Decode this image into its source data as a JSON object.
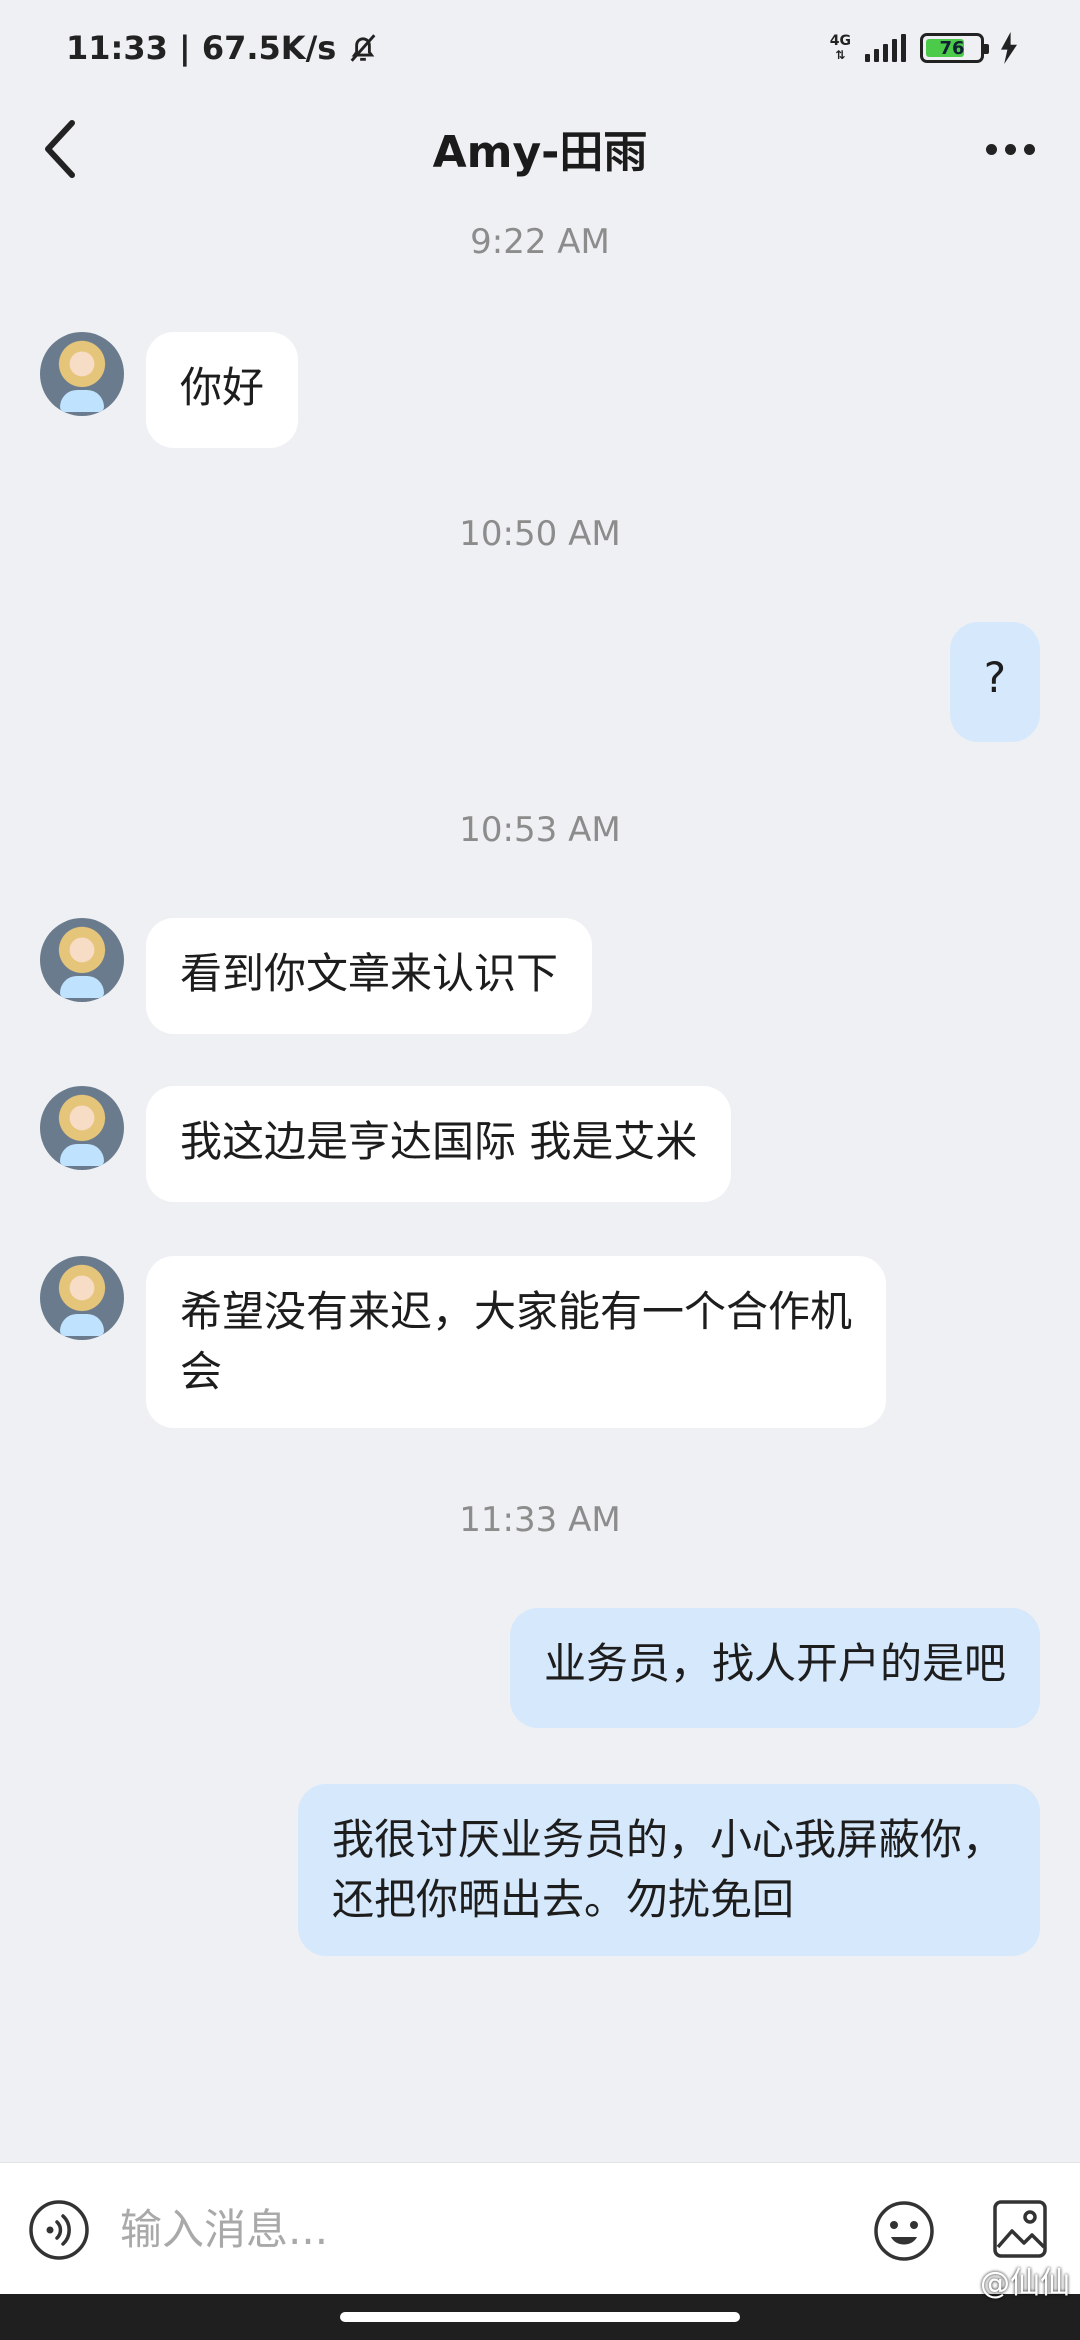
{
  "status_bar": {
    "time_speed": "11:33 | 67.5K/s",
    "network": "4G",
    "battery": "76",
    "battery_level": 0.76
  },
  "header": {
    "title": "Amy-田雨"
  },
  "messages": [
    {
      "type": "time",
      "text": "9:22 AM"
    },
    {
      "type": "left",
      "text": "你好"
    },
    {
      "type": "time",
      "text": "10:50 AM"
    },
    {
      "type": "right",
      "text": "?"
    },
    {
      "type": "time",
      "text": "10:53 AM"
    },
    {
      "type": "left",
      "text": "看到你文章来认识下"
    },
    {
      "type": "left",
      "text": "我这边是亨达国际  我是艾米"
    },
    {
      "type": "left",
      "text": "希望没有来迟，大家能有一个合作机会"
    },
    {
      "type": "time",
      "text": "11:33 AM"
    },
    {
      "type": "right",
      "text": "业务员，找人开户的是吧"
    },
    {
      "type": "right",
      "text": "我很讨厌业务员的，小心我屏蔽你，还把你晒出去。勿扰免回"
    }
  ],
  "input": {
    "placeholder": "输入消息...",
    "value": ""
  },
  "watermark": "@仙仙",
  "colors": {
    "background": "#eff0f3",
    "incoming_bubble": "#ffffff",
    "outgoing_bubble": "#d6e8fb",
    "timestamp": "#8c8c8c"
  }
}
